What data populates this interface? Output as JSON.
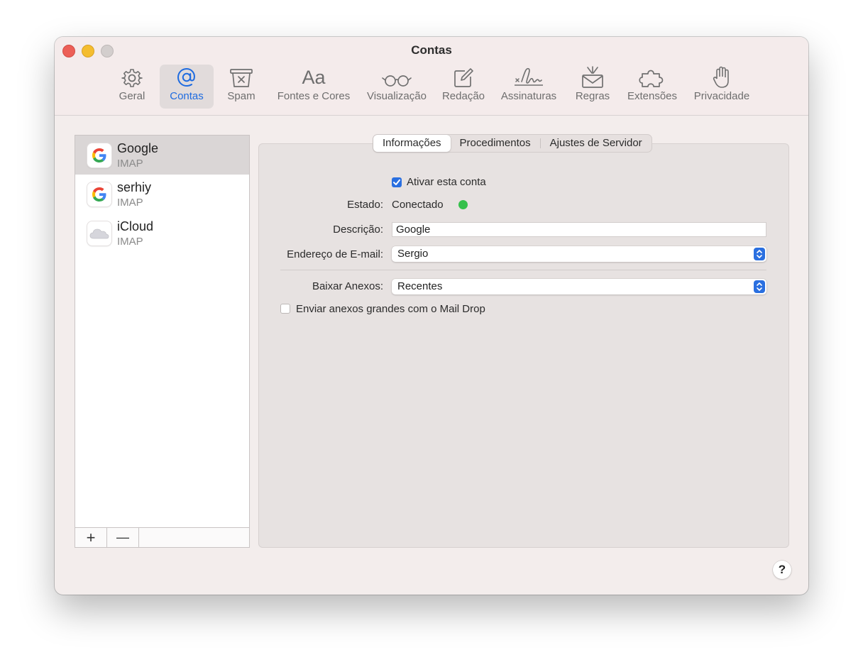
{
  "window": {
    "title": "Contas"
  },
  "toolbar": {
    "items": [
      {
        "label": "Geral",
        "icon": "gear-icon"
      },
      {
        "label": "Contas",
        "icon": "at-sign-icon",
        "active": true
      },
      {
        "label": "Spam",
        "icon": "junk-tray-icon"
      },
      {
        "label": "Fontes e Cores",
        "icon": "font-aa-icon",
        "glyph": "Aa"
      },
      {
        "label": "Visualização",
        "icon": "glasses-icon"
      },
      {
        "label": "Redação",
        "icon": "compose-icon"
      },
      {
        "label": "Assinaturas",
        "icon": "signature-icon"
      },
      {
        "label": "Regras",
        "icon": "rules-envelope-icon"
      },
      {
        "label": "Extensões",
        "icon": "puzzle-icon"
      },
      {
        "label": "Privacidade",
        "icon": "hand-icon"
      }
    ]
  },
  "accounts": [
    {
      "name": "Google",
      "type": "IMAP",
      "icon": "google-icon",
      "selected": true
    },
    {
      "name": "serhiy",
      "type": "IMAP",
      "icon": "google-icon"
    },
    {
      "name": "iCloud",
      "type": "IMAP",
      "icon": "icloud-icon"
    }
  ],
  "sidebar": {
    "add_label": "+",
    "remove_label": "—"
  },
  "tabs": [
    {
      "label": "Informações",
      "active": true
    },
    {
      "label": "Procedimentos"
    },
    {
      "label": "Ajustes de Servidor"
    }
  ],
  "form": {
    "enable_label": "Ativar esta conta",
    "enable_checked": true,
    "status_label": "Estado:",
    "status_value": "Conectado",
    "status_color": "#35c04b",
    "description_label": "Descrição:",
    "description_value": "Google",
    "email_label": "Endereço de E-mail:",
    "email_value": "Sergio",
    "attachments_label": "Baixar Anexos:",
    "attachments_value": "Recentes",
    "maildrop_label": "Enviar anexos grandes com o Mail Drop",
    "maildrop_checked": false
  },
  "help": {
    "label": "?"
  },
  "colors": {
    "accent": "#1e6be0",
    "red": "#ec5f57",
    "yellow": "#f4bd2f"
  }
}
